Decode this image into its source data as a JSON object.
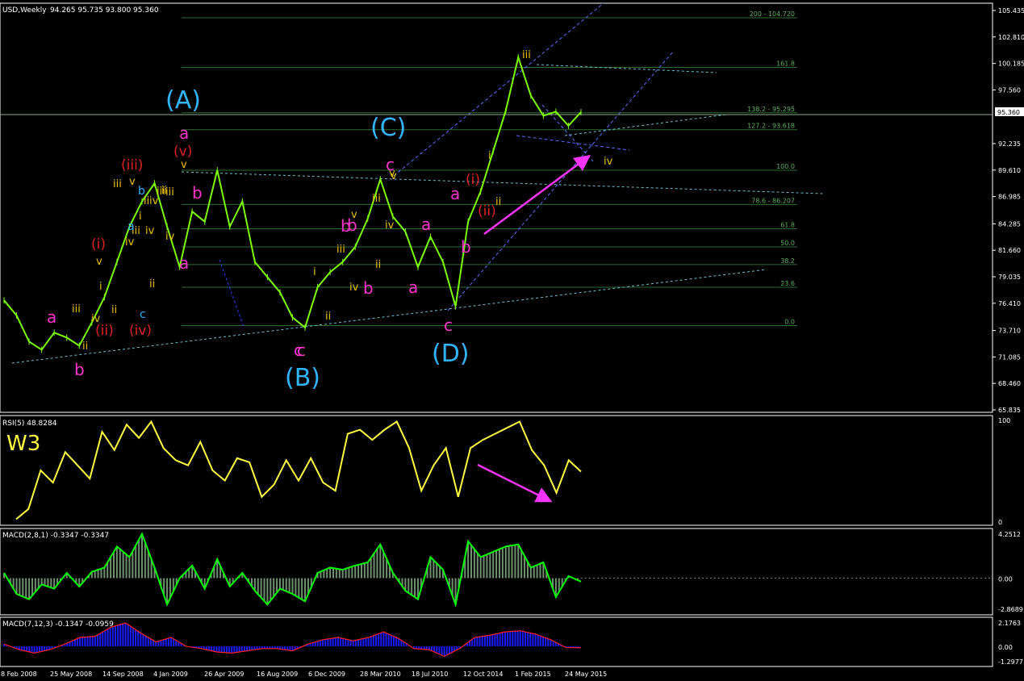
{
  "header": {
    "symbol": "USD,Weekly",
    "ohlc": "94.265 95.735 93.800 95.360"
  },
  "colors": {
    "background": "#000000",
    "price_line": "#7CFC00",
    "grid_line": "#2e6b2e",
    "rsi_line": "#FFFF40",
    "macd_line": "#00FF00",
    "macd_hist": "#6f8f6f",
    "macd2_hist": "#1a1aff",
    "macd2_signal": "#ff2020",
    "channel": "#5a6dff",
    "trend": "#6fbfd0",
    "arrow": "#ff33ff"
  },
  "chart_data": [
    {
      "type": "line",
      "title": "USD,Weekly",
      "ylim": [
        65.835,
        105.435
      ],
      "yticks": [
        "105.435",
        "102.810",
        "100.185",
        "97.560",
        "92.235",
        "89.610",
        "86.985",
        "84.285",
        "81.660",
        "79.035",
        "76.410",
        "73.710",
        "71.085",
        "68.460",
        "65.835"
      ],
      "current_price": "95.360",
      "x": [
        "Feb 2008",
        "May 2008",
        "Sep 2008",
        "Jan 2009",
        "Apr 2009",
        "Aug 2009",
        "Dec 2009",
        "Mar 2010",
        "Jul 2010",
        "Oct 2014",
        "Feb 2015",
        "May 2015"
      ],
      "xtick_labels": [
        "8 Feb 2008",
        "25 May 2008",
        "14 Sep 2008",
        "4 Jan 2009",
        "26 Apr 2009",
        "16 Aug 2009",
        "6 Dec 2009",
        "28 Mar 2010",
        "18 Jul 2010",
        "12 Oct 2014",
        "1 Feb 2015",
        "24 May 2015"
      ],
      "series": [
        {
          "values": [
            76.7,
            75.2,
            72.6,
            71.8,
            73.5,
            73.0,
            72.2,
            74.5,
            77.0,
            80.5,
            84.0,
            86.5,
            88.3,
            84.0,
            80.0,
            85.5,
            84.5,
            89.6,
            84.0,
            86.5,
            80.5,
            79.0,
            77.5,
            75.0,
            74.0,
            78.0,
            79.5,
            80.5,
            82.0,
            84.8,
            88.7,
            85.0,
            83.5,
            80.0,
            83.0,
            80.5,
            76.1,
            84.5,
            87.5,
            91.5,
            95.5,
            100.8,
            97.0,
            95.0,
            95.4,
            94.0,
            95.36
          ]
        }
      ],
      "fib_levels": [
        {
          "label": "200 - 104.720",
          "value": 104.72
        },
        {
          "label": "161.8",
          "value": 99.8
        },
        {
          "label": "138.2 - 95.295",
          "value": 95.295
        },
        {
          "label": "127.2 - 93.618",
          "value": 93.618
        },
        {
          "label": "100.0",
          "value": 89.6
        },
        {
          "label": "78.6 - 86.207",
          "value": 86.207
        },
        {
          "label": "61.8",
          "value": 83.8
        },
        {
          "label": "50.0",
          "value": 82.0
        },
        {
          "label": "38.2",
          "value": 80.25
        },
        {
          "label": "23.6",
          "value": 78.0
        },
        {
          "label": "0.0",
          "value": 74.2
        }
      ]
    },
    {
      "type": "line",
      "title": "RSI(5) 48.8284",
      "ylim": [
        0,
        100
      ],
      "yticks": [
        "100",
        "0"
      ],
      "series": [
        {
          "values": [
            2,
            12,
            50,
            38,
            68,
            55,
            42,
            88,
            70,
            95,
            82,
            98,
            72,
            60,
            55,
            78,
            50,
            40,
            62,
            58,
            24,
            36,
            60,
            40,
            62,
            38,
            30,
            86,
            90,
            80,
            90,
            98,
            72,
            30,
            55,
            72,
            24,
            72,
            80,
            86,
            92,
            98,
            70,
            55,
            28,
            60,
            48.8
          ]
        }
      ]
    },
    {
      "type": "area",
      "title": "MACD(2,8,1) -0.3347 -0.3347",
      "ylim": [
        -2.8689,
        4.2512
      ],
      "yticks": [
        "4.2512",
        "0.00",
        "-2.8689"
      ],
      "series": [
        {
          "values": [
            0.5,
            -1.5,
            -2.0,
            -0.6,
            -1.0,
            0.5,
            -0.8,
            0.6,
            1.0,
            3.0,
            2.0,
            4.2,
            1.0,
            -2.5,
            0.0,
            1.2,
            -1.0,
            1.8,
            -0.8,
            0.5,
            -1.2,
            -2.5,
            -1.0,
            -1.5,
            -2.2,
            0.5,
            1.0,
            0.8,
            1.2,
            1.5,
            3.2,
            0.5,
            -1.2,
            -2.0,
            2.0,
            0.8,
            -2.5,
            3.5,
            2.0,
            2.5,
            3.0,
            3.2,
            1.0,
            1.5,
            -1.8,
            0.2,
            -0.33
          ]
        }
      ]
    },
    {
      "type": "area",
      "title": "MACD(7,12,3) -0.1347 -0.0959",
      "ylim": [
        -1.2977,
        2.1763
      ],
      "yticks": [
        "2.1763",
        "0.00",
        "-1.2977"
      ],
      "series": [
        {
          "values": [
            0.2,
            -0.3,
            -0.6,
            -0.3,
            0.2,
            0.8,
            0.9,
            1.7,
            2.1,
            1.2,
            0.4,
            0.8,
            0.0,
            -0.2,
            -0.5,
            -0.6,
            -0.4,
            -0.2,
            -0.2,
            -0.4,
            0.2,
            0.6,
            0.8,
            0.5,
            0.8,
            1.3,
            0.7,
            -0.2,
            -0.3,
            -0.9,
            -0.2,
            0.8,
            1.0,
            1.3,
            1.4,
            1.1,
            0.6,
            -0.1,
            -0.13
          ]
        }
      ]
    }
  ],
  "wave_labels": [
    {
      "text": "(A)",
      "color": "#33b4ff"
    },
    {
      "text": "(B)",
      "color": "#33b4ff"
    },
    {
      "text": "(C)",
      "color": "#33b4ff"
    },
    {
      "text": "(D)",
      "color": "#33b4ff"
    },
    {
      "text": "a",
      "color": "#ff33cc"
    },
    {
      "text": "b",
      "color": "#ff33cc"
    },
    {
      "text": "c",
      "color": "#ff33cc"
    },
    {
      "text": "a",
      "color": "#ff33cc"
    },
    {
      "text": "b",
      "color": "#ff33cc"
    },
    {
      "text": "c",
      "color": "#ff33cc"
    },
    {
      "text": "a",
      "color": "#ff33cc"
    },
    {
      "text": "b",
      "color": "#ff33cc"
    },
    {
      "text": "c",
      "color": "#ff33cc"
    },
    {
      "text": "a",
      "color": "#ff33cc"
    },
    {
      "text": "b",
      "color": "#ff33cc"
    },
    {
      "text": "a",
      "color": "#ff33cc"
    },
    {
      "text": "b",
      "color": "#ff33cc"
    },
    {
      "text": "c",
      "color": "#ff33cc"
    },
    {
      "text": "a",
      "color": "#ff33cc"
    },
    {
      "text": "b",
      "color": "#ff33cc"
    },
    {
      "text": "(i)",
      "color": "#e02020"
    },
    {
      "text": "(ii)",
      "color": "#e02020"
    },
    {
      "text": "(iii)",
      "color": "#e02020"
    },
    {
      "text": "(iv)",
      "color": "#e02020"
    },
    {
      "text": "(v)",
      "color": "#e02020"
    },
    {
      "text": "(i)",
      "color": "#e02020"
    },
    {
      "text": "(ii)",
      "color": "#e02020"
    },
    {
      "text": "iii",
      "color": "#e8c000"
    },
    {
      "text": "iv",
      "color": "#e8c000"
    },
    {
      "text": "ii",
      "color": "#e8c000"
    },
    {
      "text": "i",
      "color": "#e8c000"
    },
    {
      "text": "ii",
      "color": "#e8c000"
    },
    {
      "text": "v",
      "color": "#e8c000"
    },
    {
      "text": "iv",
      "color": "#e8c000"
    },
    {
      "text": "iii",
      "color": "#e8c000"
    },
    {
      "text": "v",
      "color": "#e8c000"
    },
    {
      "text": "ii",
      "color": "#e8c000"
    },
    {
      "text": "i",
      "color": "#e8c000"
    },
    {
      "text": "iii",
      "color": "#e8c000"
    },
    {
      "text": "iv",
      "color": "#e8c000"
    },
    {
      "text": "iii",
      "color": "#e8c000"
    },
    {
      "text": "ii",
      "color": "#e8c000"
    },
    {
      "text": "iv",
      "color": "#e8c000"
    },
    {
      "text": "iii",
      "color": "#e8c000"
    },
    {
      "text": "v",
      "color": "#e8c000"
    },
    {
      "text": "v",
      "color": "#e8c000"
    },
    {
      "text": "ii",
      "color": "#e8c000"
    },
    {
      "text": "i",
      "color": "#e8c000"
    },
    {
      "text": "ii",
      "color": "#e8c000"
    },
    {
      "text": "iii",
      "color": "#e8c000"
    },
    {
      "text": "v",
      "color": "#e8c000"
    },
    {
      "text": "iv",
      "color": "#e8c000"
    },
    {
      "text": "iv",
      "color": "#e8c000"
    },
    {
      "text": "ii",
      "color": "#e8c000"
    },
    {
      "text": "iii",
      "color": "#e8c000"
    },
    {
      "text": "iv",
      "color": "#e8c000"
    },
    {
      "text": "v",
      "color": "#e8c000"
    },
    {
      "text": "i",
      "color": "#e8c000"
    },
    {
      "text": "ii",
      "color": "#e8c000"
    },
    {
      "text": "iii",
      "color": "#e8c000"
    },
    {
      "text": "iv",
      "color": "#e8c000"
    },
    {
      "text": "b",
      "color": "#33b4ff"
    },
    {
      "text": "a",
      "color": "#33b4ff"
    },
    {
      "text": "c",
      "color": "#33b4ff"
    }
  ],
  "rsi_annotation": "W3"
}
